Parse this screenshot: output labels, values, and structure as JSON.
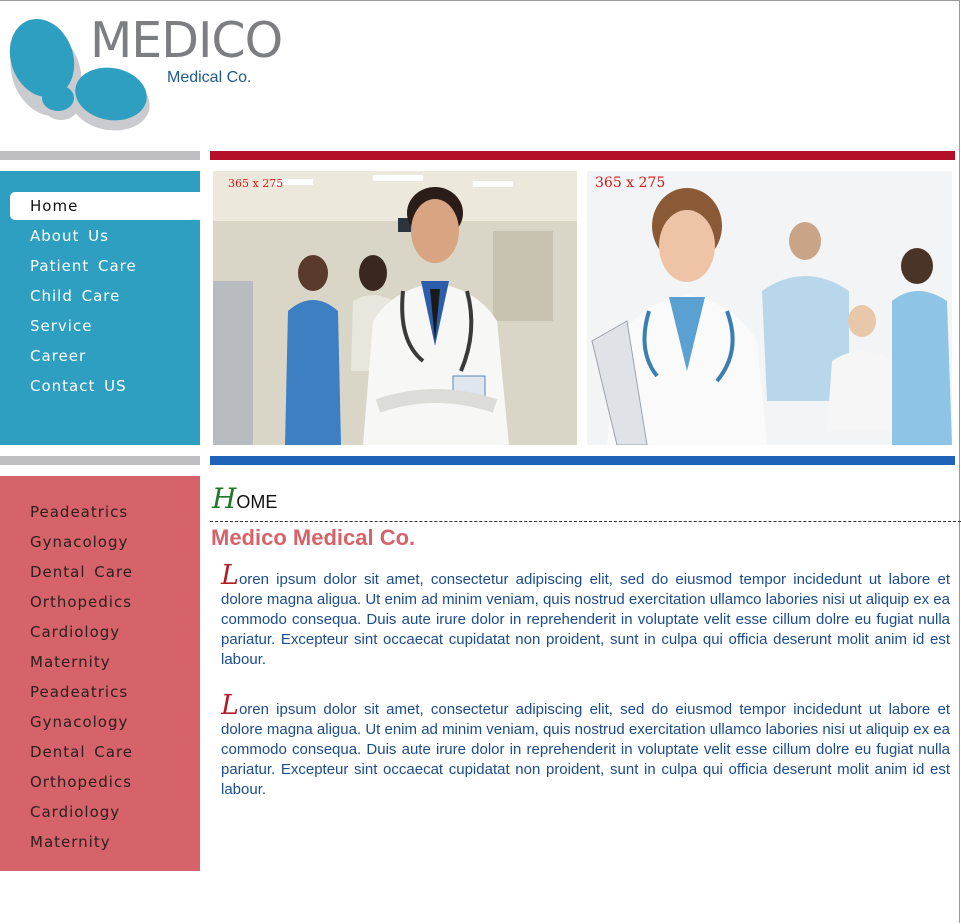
{
  "brand": {
    "title": "MEDICO",
    "subtitle": "Medical Co."
  },
  "main_nav": {
    "items": [
      {
        "label": "Home",
        "active": true
      },
      {
        "label": "About Us",
        "active": false
      },
      {
        "label": "Patient Care",
        "active": false
      },
      {
        "label": "Child Care",
        "active": false
      },
      {
        "label": "Service",
        "active": false
      },
      {
        "label": "Career",
        "active": false
      },
      {
        "label": "Contact US",
        "active": false
      }
    ]
  },
  "side_nav": {
    "items": [
      "Peadeatrics",
      "Gynacology",
      "Dental Care",
      "Orthopedics",
      "Cardiology",
      "Maternity",
      "Peadeatrics",
      "Gynacology",
      "Dental Care",
      "Orthopedics",
      "Cardiology",
      "Maternity"
    ]
  },
  "images": [
    {
      "label": "365 x 275"
    },
    {
      "label": "365 x 275"
    }
  ],
  "content": {
    "heading_cap": "H",
    "heading_rest": "OME",
    "company": "Medico Medical Co.",
    "paragraphs": [
      {
        "cap": "L",
        "text": "oren ipsum dolor sit amet, consectetur adipiscing elit, sed do eiusmod tempor incidedunt ut labore et dolore magna aligua. Ut enim ad minim veniam, quis nostrud exercitation ullamco labories nisi ut aliquip ex ea commodo consequa. Duis aute irure dolor in reprehenderit in voluptate velit esse cillum dolre eu fugiat nulla pariatur. Excepteur sint occaecat cupidatat non proident, sunt in culpa qui officia deserunt molit anim id est labour."
      },
      {
        "cap": "L",
        "text": "oren ipsum dolor sit amet, consectetur adipiscing elit, sed do eiusmod tempor incidedunt ut labore et dolore magna aligua. Ut enim ad minim veniam, quis nostrud exercitation ullamco labories nisi ut aliquip ex ea commodo consequa. Duis aute irure dolor in reprehenderit in voluptate velit esse cillum dolre eu fugiat nulla pariatur. Excepteur sint occaecat cupidatat non proident, sunt in culpa qui officia deserunt molit anim id est labour."
      }
    ]
  },
  "colors": {
    "nav_blue": "#2e9fc0",
    "side_red": "#d7636a",
    "bar_red": "#b4102a",
    "bar_blue": "#1e63b8",
    "text_blue": "#1c4c8c"
  }
}
